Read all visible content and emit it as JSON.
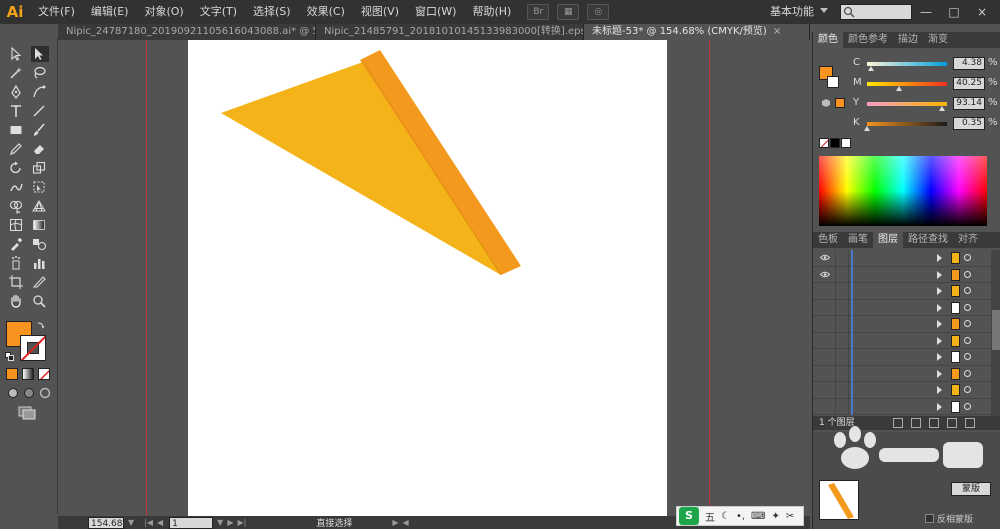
{
  "app": {
    "logo": "Ai"
  },
  "menu": {
    "items": [
      "文件(F)",
      "编辑(E)",
      "对象(O)",
      "文字(T)",
      "选择(S)",
      "效果(C)",
      "视图(V)",
      "窗口(W)",
      "帮助(H)"
    ],
    "workspace": "基本功能",
    "search_placeholder": ""
  },
  "window_controls": {
    "minimize": "—",
    "restore": "□",
    "close": "×"
  },
  "tabs": [
    {
      "label": "Nipic_24787180_20190921105616043088.ai* @ 50...",
      "active": false,
      "close": "×"
    },
    {
      "label": "Nipic_21485791_20181010145133983000[转换].eps*",
      "active": false,
      "close": "×"
    },
    {
      "label": "未标题-53* @ 154.68% (CMYK/预览)",
      "active": true,
      "close": "×"
    }
  ],
  "toolbar": {
    "tools": [
      "selection-tool",
      "direct-selection-tool",
      "magic-wand-tool",
      "lasso-tool",
      "pen-tool",
      "curvature-tool",
      "type-tool",
      "line-tool",
      "rectangle-tool",
      "paintbrush-tool",
      "pencil-tool",
      "eraser-tool",
      "rotate-tool",
      "scale-tool",
      "warp-tool",
      "free-transform-tool",
      "shape-builder-tool",
      "perspective-grid-tool",
      "mesh-tool",
      "gradient-tool",
      "eyedropper-tool",
      "blend-tool",
      "symbol-sprayer-tool",
      "column-graph-tool",
      "artboard-tool",
      "slice-tool",
      "hand-tool",
      "zoom-tool"
    ],
    "fill_color": "#f7931e",
    "stroke_color": "#ffffff"
  },
  "artwork": {
    "triangle_color": "#f4b318",
    "band_color": "#f39a1e",
    "guide_color": "#b73b3b"
  },
  "status": {
    "zoom": "154.68",
    "page": "1",
    "tool": "直接选择"
  },
  "color_panel": {
    "tabs": [
      "颜色",
      "颜色参考",
      "描边",
      "渐变"
    ],
    "fill_color": "#f7931e",
    "cmyk": [
      {
        "label": "C",
        "value": "4.38",
        "level": 0.044,
        "gradient": "linear-gradient(to right,#fff3d8,#00a0e0)"
      },
      {
        "label": "M",
        "value": "40.25",
        "level": 0.4025,
        "gradient": "linear-gradient(to right,#ffe600,#f03020)"
      },
      {
        "label": "Y",
        "value": "93.14",
        "level": 0.9314,
        "gradient": "linear-gradient(to right,#f89cc8,#f7b500)"
      },
      {
        "label": "K",
        "value": "0.35",
        "level": 0.0035,
        "gradient": "linear-gradient(to right,#f7931e,#1a1a1a)"
      }
    ],
    "pct": "%"
  },
  "layers_panel": {
    "tabs": [
      "色板",
      "画笔",
      "图层",
      "路径查找",
      "对齐"
    ],
    "active_tab": "图层",
    "rows": [
      {
        "visible": true,
        "thumb": "#f4b318"
      },
      {
        "visible": true,
        "thumb": "#f39a1e"
      },
      {
        "visible": false,
        "thumb": "#f4b318"
      },
      {
        "visible": false,
        "thumb": "#ffffff"
      },
      {
        "visible": false,
        "thumb": "#f39a1e"
      },
      {
        "visible": false,
        "thumb": "#f4b318"
      },
      {
        "visible": false,
        "thumb": "#ffffff"
      },
      {
        "visible": false,
        "thumb": "#f39a1e"
      },
      {
        "visible": false,
        "thumb": "#f4b318"
      },
      {
        "visible": false,
        "thumb": "#ffffff"
      }
    ],
    "footer": "1 个图层"
  },
  "transparency_panel": {
    "mask_button": "蒙版",
    "invert_label": "反相蒙版"
  },
  "ime": {
    "logo": "S",
    "mode": "五",
    "icons": [
      "moon-icon",
      "punctuation-icon",
      "keyboard-icon",
      "settings-icon",
      "skin-icon"
    ]
  }
}
